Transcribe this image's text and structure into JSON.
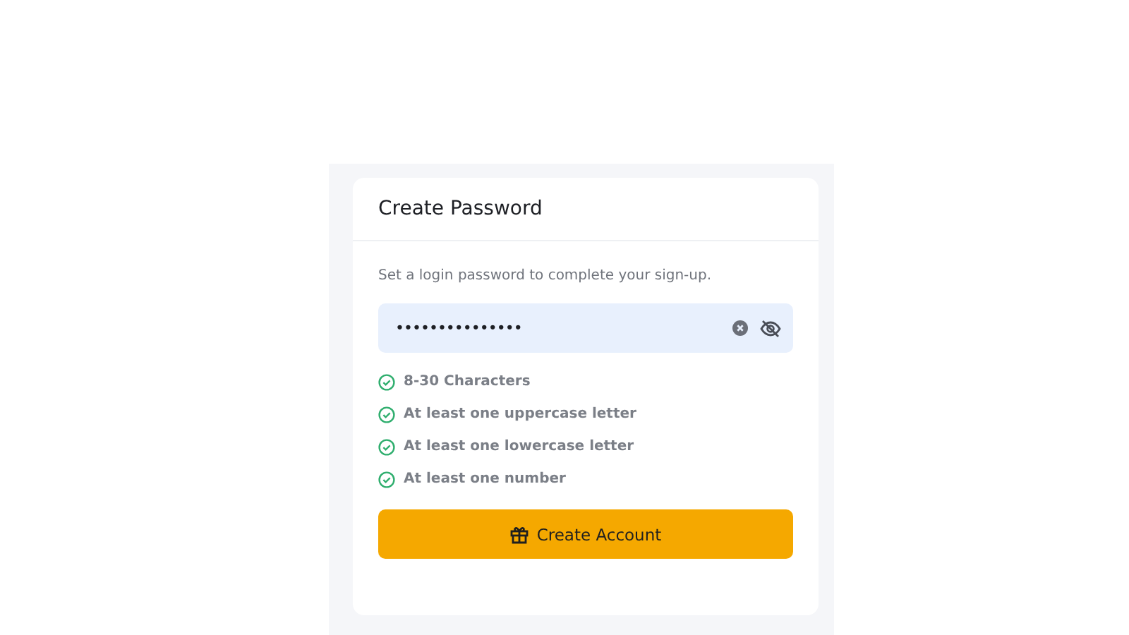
{
  "dialog": {
    "title": "Create Password",
    "description": "Set a login password to complete your sign-up."
  },
  "password_field": {
    "value": "•••••••••••••••",
    "visible": false
  },
  "rules": [
    {
      "label": "8-30 Characters",
      "met": true
    },
    {
      "label": "At least one uppercase letter",
      "met": true
    },
    {
      "label": "At least one lowercase letter",
      "met": true
    },
    {
      "label": "At least one number",
      "met": true
    }
  ],
  "submit_button": {
    "label": "Create Account"
  }
}
